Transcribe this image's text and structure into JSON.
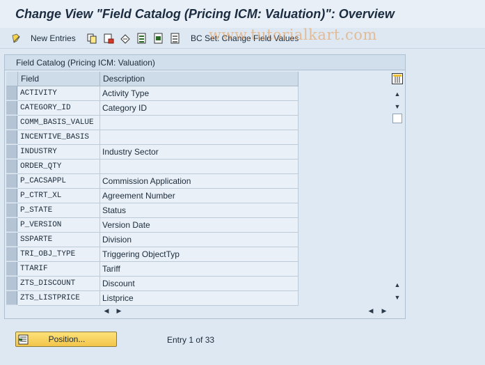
{
  "window": {
    "title": "Change View \"Field Catalog (Pricing ICM: Valuation)\": Overview"
  },
  "toolbar": {
    "new_entries_label": "New Entries",
    "bc_set_label": "BC Set: Change Field Values",
    "icons": [
      "new-entries-icon",
      "copy-icon",
      "delete-icon",
      "undo-icon",
      "select-all-icon",
      "select-block-icon",
      "deselect-all-icon",
      "bc-set-icon"
    ]
  },
  "watermark": "www.tutorialkart.com",
  "panel": {
    "title": "Field Catalog (Pricing ICM: Valuation)",
    "columns": {
      "field": "Field",
      "description": "Description"
    },
    "rows": [
      {
        "field": "ACTIVITY",
        "description": "Activity Type"
      },
      {
        "field": "CATEGORY_ID",
        "description": "Category ID"
      },
      {
        "field": "COMM_BASIS_VALUE",
        "description": ""
      },
      {
        "field": "INCENTIVE_BASIS",
        "description": ""
      },
      {
        "field": "INDUSTRY",
        "description": "Industry Sector"
      },
      {
        "field": "ORDER_QTY",
        "description": ""
      },
      {
        "field": "P_CACSAPPL",
        "description": "Commission Application"
      },
      {
        "field": "P_CTRT_XL",
        "description": "Agreement Number"
      },
      {
        "field": "P_STATE",
        "description": "Status"
      },
      {
        "field": "P_VERSION",
        "description": "Version Date"
      },
      {
        "field": "SSPARTE",
        "description": "Division"
      },
      {
        "field": "TRI_OBJ_TYPE",
        "description": "Triggering ObjectTyp"
      },
      {
        "field": "TTARIF",
        "description": "Tariff"
      },
      {
        "field": "ZTS_DISCOUNT",
        "description": "Discount"
      },
      {
        "field": "ZTS_LISTPRICE",
        "description": "Listprice"
      }
    ]
  },
  "bottom": {
    "position_button_label": "Position...",
    "entry_status": "Entry 1 of 33"
  },
  "colors": {
    "background": "#dde8f2",
    "button_accent": "#f3c54a",
    "watermark": "#e8964b"
  }
}
